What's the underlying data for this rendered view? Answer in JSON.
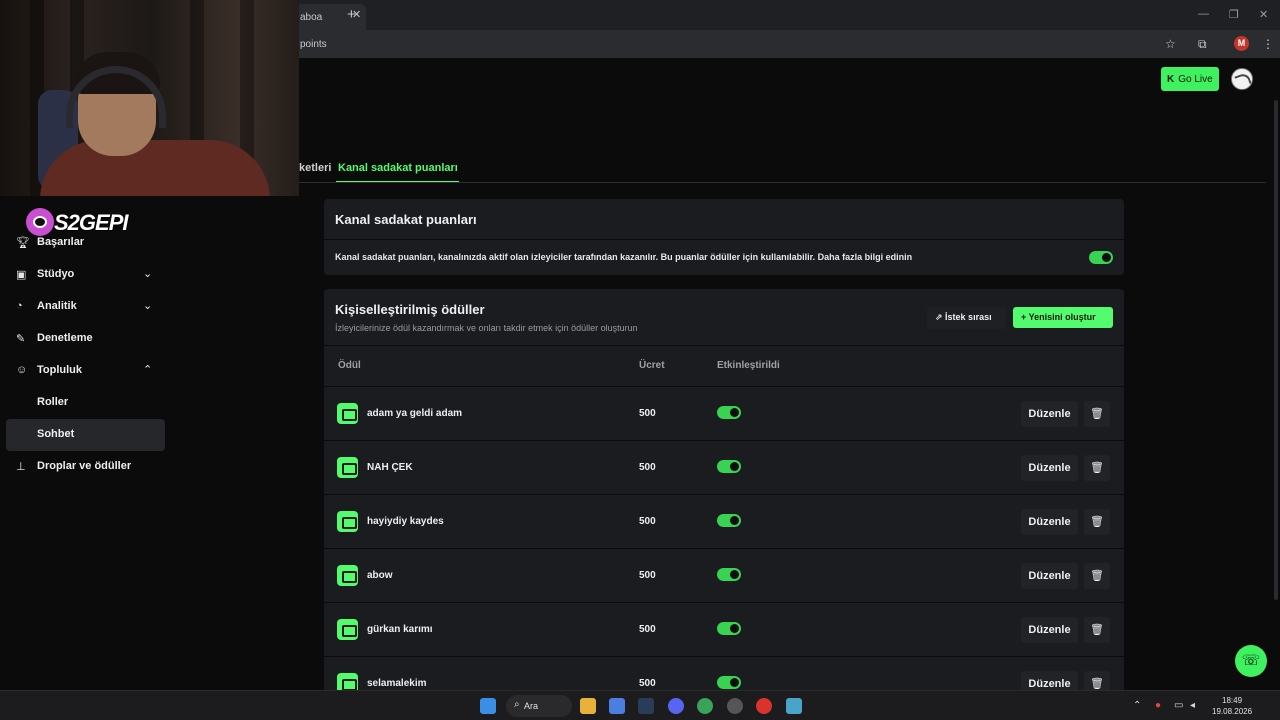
{
  "browser": {
    "tab_title": "aboa",
    "new_tab": "+",
    "url": "points",
    "profile_initial": "M"
  },
  "overlay": {
    "logo_text": "S2GEPI"
  },
  "sidebar": {
    "items": [
      {
        "label": "Başarılar",
        "icon": "trophy-icon"
      },
      {
        "label": "Stüdyo",
        "icon": "studio-icon",
        "chevron": "down"
      },
      {
        "label": "Analitik",
        "icon": "analytics-icon",
        "chevron": "down"
      },
      {
        "label": "Denetleme",
        "icon": "wrench-icon"
      },
      {
        "label": "Topluluk",
        "icon": "community-icon",
        "chevron": "up"
      },
      {
        "label": "Roller"
      },
      {
        "label": "Sohbet",
        "active": true
      },
      {
        "label": "Droplar ve ödüller",
        "icon": "drops-icon"
      }
    ]
  },
  "header": {
    "go_live_label": "Go Live"
  },
  "tabs": {
    "previous_partial": "ketleri",
    "active": "Kanal sadakat puanları"
  },
  "loyalty_card": {
    "title": "Kanal sadakat puanları",
    "description": "Kanal sadakat puanları, kanalınızda aktif olan izleyiciler tarafından kazanılır. Bu puanlar ödüller için kullanılabilir. Daha fazla bilgi edinin",
    "enabled": true
  },
  "rewards_card": {
    "title": "Kişiselleştirilmiş ödüller",
    "subtitle": "İzleyicilerinize ödül kazandırmak ve onları takdir etmek için ödüller oluşturun",
    "queue_button": "İstek sırası",
    "create_button": "Yenisini oluştur",
    "columns": {
      "reward": "Ödül",
      "cost": "Ücret",
      "enabled": "Etkinleştirildi"
    },
    "edit_label": "Düzenle",
    "rows": [
      {
        "name": "adam ya geldi adam",
        "cost": "500",
        "enabled": true
      },
      {
        "name": "NAH ÇEK",
        "cost": "500",
        "enabled": true
      },
      {
        "name": "hayiydiy kaydes",
        "cost": "500",
        "enabled": true
      },
      {
        "name": "abow",
        "cost": "500",
        "enabled": true
      },
      {
        "name": "gürkan karımı",
        "cost": "500",
        "enabled": true
      },
      {
        "name": "selamalekim",
        "cost": "500",
        "enabled": true
      }
    ]
  },
  "taskbar": {
    "search_label": "Ara",
    "time": "18:49",
    "date": "19.08.2026"
  },
  "colors": {
    "accent": "#53fc6e",
    "background": "#0b0b0c",
    "card": "#1b1c1f"
  }
}
